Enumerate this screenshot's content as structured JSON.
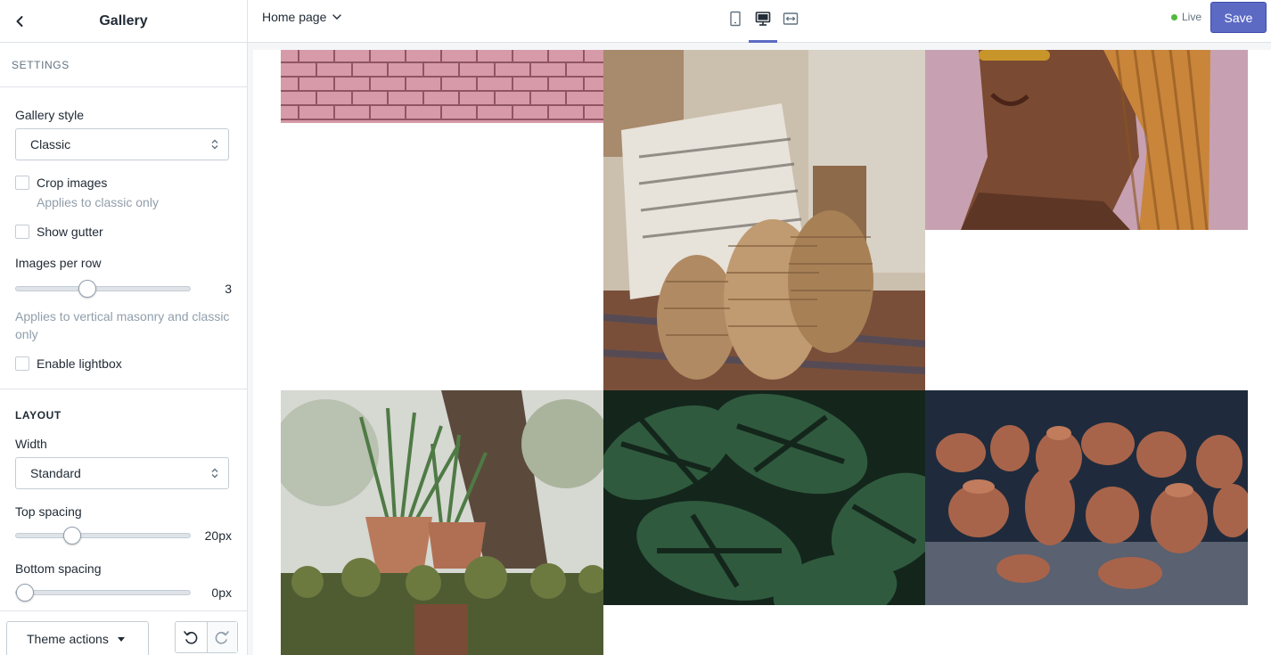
{
  "sidebar": {
    "title": "Gallery",
    "settings_heading": "SETTINGS",
    "gallery_style": {
      "label": "Gallery style",
      "value": "Classic"
    },
    "crop_images": {
      "label": "Crop images",
      "help": "Applies to classic only",
      "checked": false
    },
    "show_gutter": {
      "label": "Show gutter",
      "checked": false
    },
    "images_per_row": {
      "label": "Images per row",
      "value": "3",
      "fraction": 0.4,
      "help": "Applies to vertical masonry and classic only"
    },
    "enable_lightbox": {
      "label": "Enable lightbox",
      "checked": false
    },
    "layout_heading": "LAYOUT",
    "width": {
      "label": "Width",
      "value": "Standard"
    },
    "top_spacing": {
      "label": "Top spacing",
      "value": "20px",
      "fraction": 0.3
    },
    "bottom_spacing": {
      "label": "Bottom spacing",
      "value": "0px",
      "fraction": 0.0
    },
    "theme_actions_label": "Theme actions"
  },
  "topbar": {
    "page_select": "Home page",
    "status": "Live",
    "save_label": "Save",
    "active_view": "desktop-view-icon"
  },
  "colors": {
    "accent": "#5c6ac4",
    "live": "#50b83c"
  }
}
